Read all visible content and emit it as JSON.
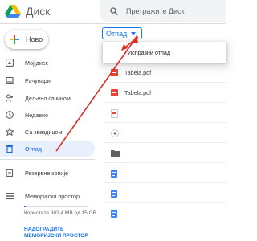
{
  "app": {
    "title": "Диск"
  },
  "search": {
    "placeholder": "Претражите Диск"
  },
  "new_button": {
    "label": "Ново"
  },
  "sidebar": {
    "items": [
      {
        "label": "Мој диск",
        "icon": "my-drive-icon"
      },
      {
        "label": "Рачунари",
        "icon": "computers-icon"
      },
      {
        "label": "Дељено са мном",
        "icon": "shared-icon"
      },
      {
        "label": "Недавно",
        "icon": "recent-icon"
      },
      {
        "label": "Са звездицом",
        "icon": "star-icon"
      },
      {
        "label": "Отпад",
        "icon": "trash-icon",
        "active": true
      },
      {
        "label": "Резервне копије",
        "icon": "backup-icon"
      },
      {
        "label": "Меморијски простор",
        "icon": "storage-icon"
      }
    ],
    "storage_used_text": "Користите 302,4 MB од 15 GB",
    "storage_used_fraction": 0.02,
    "upgrade_label": "НАДОГРАДИТЕ МЕМОРИЈСКИ ПРОСТОР"
  },
  "trash_chip": {
    "label": "Отпад"
  },
  "dropdown": {
    "items": [
      {
        "label": "Испразни отпад"
      }
    ]
  },
  "files": [
    {
      "name": "Tabela.pdf",
      "type": "pdf"
    },
    {
      "name": "Tabela.pdf",
      "type": "pdf"
    },
    {
      "name": "",
      "type": "pdf-pages"
    },
    {
      "name": "",
      "type": "media"
    },
    {
      "name": "",
      "type": "folder"
    },
    {
      "name": "",
      "type": "doc"
    },
    {
      "name": "",
      "type": "doc"
    },
    {
      "name": "",
      "type": "doc"
    }
  ],
  "colors": {
    "accent": "#1a73e8",
    "active_bg": "#e8f0fe",
    "annotation_arrow": "#d93025",
    "pdf_red": "#ea4335"
  }
}
